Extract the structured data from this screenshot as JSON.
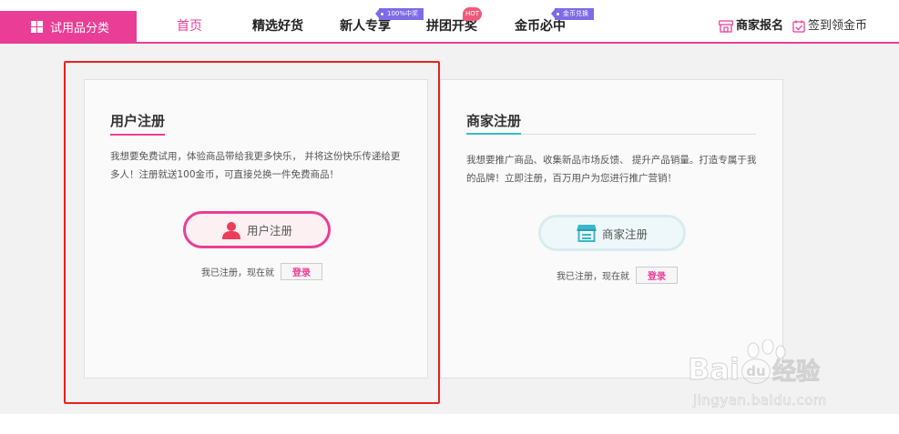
{
  "nav": {
    "category_button": "试用品分类",
    "items": [
      {
        "label": "首页"
      },
      {
        "label": "精选好货"
      },
      {
        "label": "新人专享",
        "tag": "100%中奖"
      },
      {
        "label": "拼团开奖",
        "tag": "HOT"
      },
      {
        "label": "金币必中",
        "tag": "金币兑换"
      }
    ],
    "merchant_signup": "商家报名",
    "checkin": "签到领金币",
    "colors": {
      "accent": "#ea3e96",
      "tag": "#7d6be8",
      "hot": "#f05a7a"
    }
  },
  "user_card": {
    "title": "用户注册",
    "description": "我想要免费试用，体验商品带给我更多快乐， 并将这份快乐传递给更多人！注册就送100金币，可直接兑换一件免费商品！",
    "button_label": "用户注册",
    "button_icon": "user-icon",
    "login_prompt": "我已注册，现在就",
    "login_button": "登录",
    "accent_color": "#ea3e96"
  },
  "merchant_card": {
    "title": "商家注册",
    "description": "我想要推广商品、收集新品市场反馈、 提升产品销量。打造专属于我的品牌！立即注册，百万用户为您进行推广营销！",
    "button_label": "商家注册",
    "button_icon": "storefront-icon",
    "login_prompt": "我已注册，现在就",
    "login_button": "登录",
    "accent_color": "#3ab7c9"
  },
  "watermark": {
    "logo": "Bai",
    "logo_suffix": "经验",
    "url": "jingyan.baidu.com"
  }
}
